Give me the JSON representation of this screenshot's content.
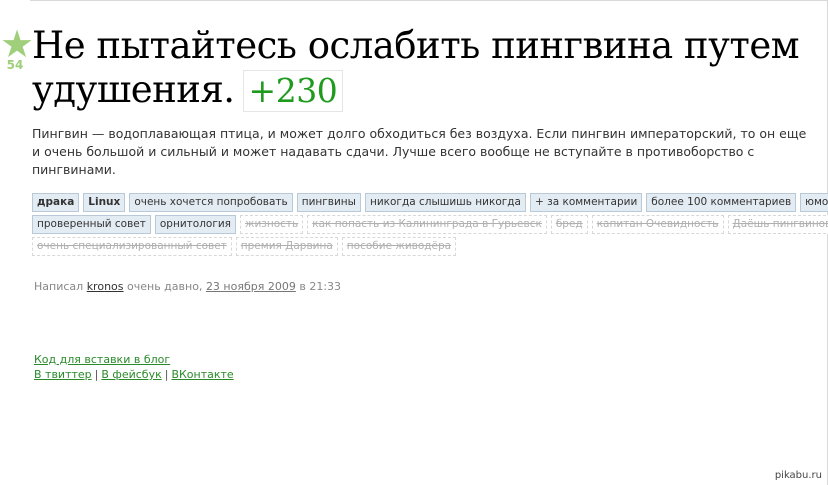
{
  "post": {
    "rating_count": "54",
    "title": "Не пытайтесь ослабить пингвина путем удушения.",
    "rating": "+230",
    "body": "Пингвин — водоплавающая птица, и может долго обходиться без воздуха. Если пингвин императорский, то он еще и очень большой и сильный и может надавать сдачи. Лучше всего вообще не вступайте в противоборство с пингвинами."
  },
  "tags": {
    "row1": [
      {
        "label": "драка",
        "style": "bold"
      },
      {
        "label": "Linux",
        "style": "bold"
      },
      {
        "label": "очень хочется попробовать",
        "style": "normal"
      },
      {
        "label": "пингвины",
        "style": "normal"
      },
      {
        "label": "никогда слышишь никогда",
        "style": "normal"
      },
      {
        "label": "+ за комментарии",
        "style": "normal"
      },
      {
        "label": "более 100 комментариев",
        "style": "normal"
      },
      {
        "label": "юмор",
        "style": "normal"
      }
    ],
    "row2": [
      {
        "label": "проверенный совет",
        "style": "normal"
      },
      {
        "label": "орнитология",
        "style": "normal"
      },
      {
        "label": "жизность",
        "style": "dead"
      },
      {
        "label": "как попасть из Калининграда в Гурьевск",
        "style": "dead"
      },
      {
        "label": "бред",
        "style": "dead"
      },
      {
        "label": "капитан Очевидность",
        "style": "dead"
      },
      {
        "label": "Даёшь пингвинов!",
        "style": "dead"
      }
    ],
    "row3": [
      {
        "label": "очень специализированный совет",
        "style": "dead"
      },
      {
        "label": "премия Дарвина",
        "style": "dead"
      },
      {
        "label": "пособие живодёра",
        "style": "dead"
      }
    ]
  },
  "byline": {
    "prefix": "Написал",
    "author": "kronos",
    "when": "очень давно,",
    "date": "23 ноября 2009",
    "time": "в 21:33"
  },
  "share": {
    "embed": "Код для вставки в блог",
    "twitter": "В твиттер",
    "facebook": "В фейсбук",
    "vkontakte": "ВКонтакте",
    "separator": "|"
  },
  "watermark": "pikabu.ru",
  "colors": {
    "rating_green": "#1e9b1e",
    "star_green": "#9fcf7a",
    "tag_bg": "#e4ecf3",
    "link_green": "#2a8a2a"
  }
}
